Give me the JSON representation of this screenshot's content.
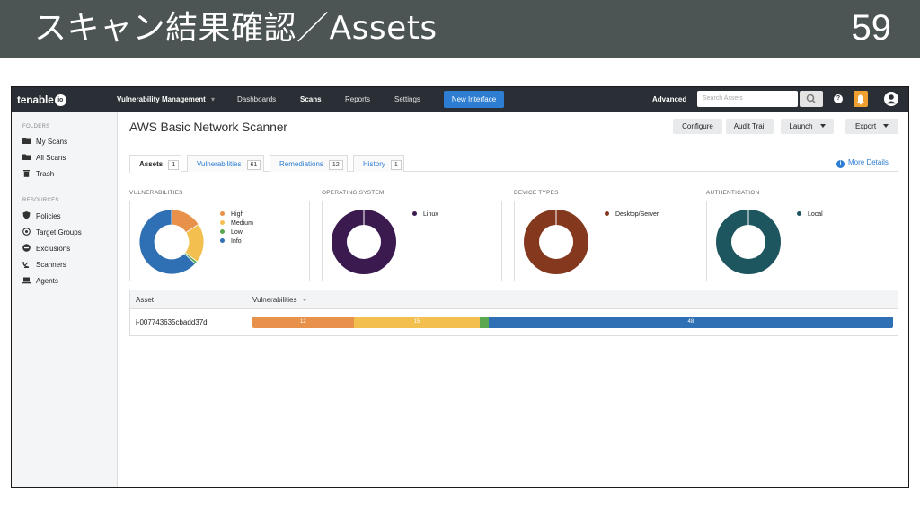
{
  "slide": {
    "title": "スキャン結果確認／Assets",
    "page_number": "59"
  },
  "colors": {
    "header_bg": "#4d5554",
    "nav_bg": "#2a2f35",
    "accent": "#2d7dd2",
    "high": "#e8914a",
    "medium": "#f3c04f",
    "low": "#5aa74f",
    "info": "#2f6fb3",
    "linux": "#3b1b4f",
    "desktop_server": "#84391f",
    "local": "#1e5660"
  },
  "topnav": {
    "logo_text": "tenable",
    "logo_suffix": "io",
    "items": [
      "Vulnerability Management",
      "Dashboards",
      "Scans",
      "Reports",
      "Settings"
    ],
    "new_interface": "New Interface",
    "advanced": "Advanced",
    "search_placeholder": "Search Assets",
    "help": "?"
  },
  "sidebar": {
    "folders_head": "FOLDERS",
    "folders": [
      "My Scans",
      "All Scans",
      "Trash"
    ],
    "resources_head": "RESOURCES",
    "resources": [
      "Policies",
      "Target Groups",
      "Exclusions",
      "Scanners",
      "Agents"
    ]
  },
  "scan": {
    "title": "AWS Basic Network Scanner",
    "buttons": [
      "Configure",
      "Audit Trail",
      "Launch",
      "Export"
    ]
  },
  "tabs": [
    {
      "label": "Assets",
      "count": "1"
    },
    {
      "label": "Vulnerabilities",
      "count": "61"
    },
    {
      "label": "Remediations",
      "count": "12"
    },
    {
      "label": "History",
      "count": "1"
    }
  ],
  "more_details": "More Details",
  "panels": {
    "vulnerabilities": {
      "title": "VULNERABILITIES",
      "legend": [
        "High",
        "Medium",
        "Low",
        "Info"
      ]
    },
    "os": {
      "title": "OPERATING SYSTEM",
      "legend": [
        "Linux"
      ]
    },
    "device": {
      "title": "DEVICE TYPES",
      "legend": [
        "Desktop/Server"
      ]
    },
    "auth": {
      "title": "AUTHENTICATION",
      "legend": [
        "Local"
      ]
    }
  },
  "chart_data": [
    {
      "type": "pie",
      "categories": [
        "High",
        "Medium",
        "Low",
        "Info"
      ],
      "values": [
        12,
        15,
        1,
        48
      ]
    },
    {
      "type": "pie",
      "categories": [
        "Linux"
      ],
      "values": [
        1
      ]
    },
    {
      "type": "pie",
      "categories": [
        "Desktop/Server"
      ],
      "values": [
        1
      ]
    },
    {
      "type": "pie",
      "categories": [
        "Local"
      ],
      "values": [
        1
      ]
    }
  ],
  "table": {
    "headers": [
      "Asset",
      "Vulnerabilities"
    ],
    "rows": [
      {
        "asset": "i-007743635cbadd37d",
        "high": "12",
        "medium": "15",
        "low": "",
        "info": "48"
      }
    ]
  }
}
